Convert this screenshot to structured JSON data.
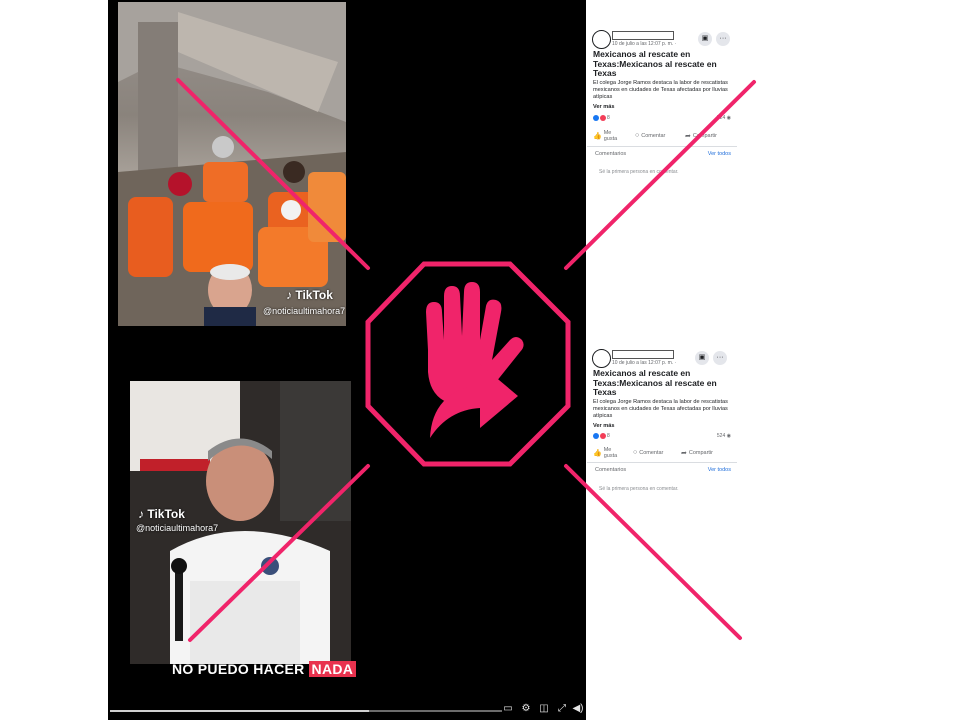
{
  "video": {
    "tiktok_label_top": "TikTok",
    "tiktok_handle_top": "@noticiaultimahora7",
    "tiktok_label_bottom": "TikTok",
    "tiktok_handle_bottom": "@noticiaultimahora7",
    "caption_part1": "NO PUEDO HACER",
    "caption_part2": "NADA",
    "progress_fraction": 0.66,
    "controls": [
      "captions-icon",
      "gear-icon",
      "pip-icon",
      "fullscreen-icon",
      "volume-icon"
    ]
  },
  "posts": [
    {
      "timestamp": "10 de julio a las 12:07 p. m. ·",
      "title": "Mexicanos al rescate en Texas:Mexicanos al rescate en Texas",
      "body": "El colega Jorge Ramos destaca la labor de rescatistas mexicanos en ciudades de Texas afectadas por lluvias atípicas",
      "see_more": "Ver más",
      "reactions": "8",
      "views": "524",
      "like_label": "Me gusta",
      "comment_label": "Comentar",
      "share_label": "Compartir",
      "comments_header": "Comentarios",
      "see_all": "Ver todos",
      "first_comment": "Sé la primera persona en comentar."
    },
    {
      "timestamp": "10 de julio a las 12:07 p. m. ·",
      "title": "Mexicanos al rescate en Texas:Mexicanos al rescate en Texas",
      "body": "El colega Jorge Ramos destaca la labor de rescatistas mexicanos en ciudades de Texas afectadas por lluvias atípicas",
      "see_more": "Ver más",
      "reactions": "8",
      "views": "524",
      "like_label": "Me gusta",
      "comment_label": "Comentar",
      "share_label": "Compartir",
      "comments_header": "Comentarios",
      "see_all": "Ver todos",
      "first_comment": "Sé la primera persona en comentar."
    }
  ],
  "colors": {
    "overlay_pink": "#f0246a",
    "video_bg": "#000000",
    "fb_link": "#216fdb"
  },
  "icons": {
    "overlay": "hand-share-stop-icon"
  }
}
